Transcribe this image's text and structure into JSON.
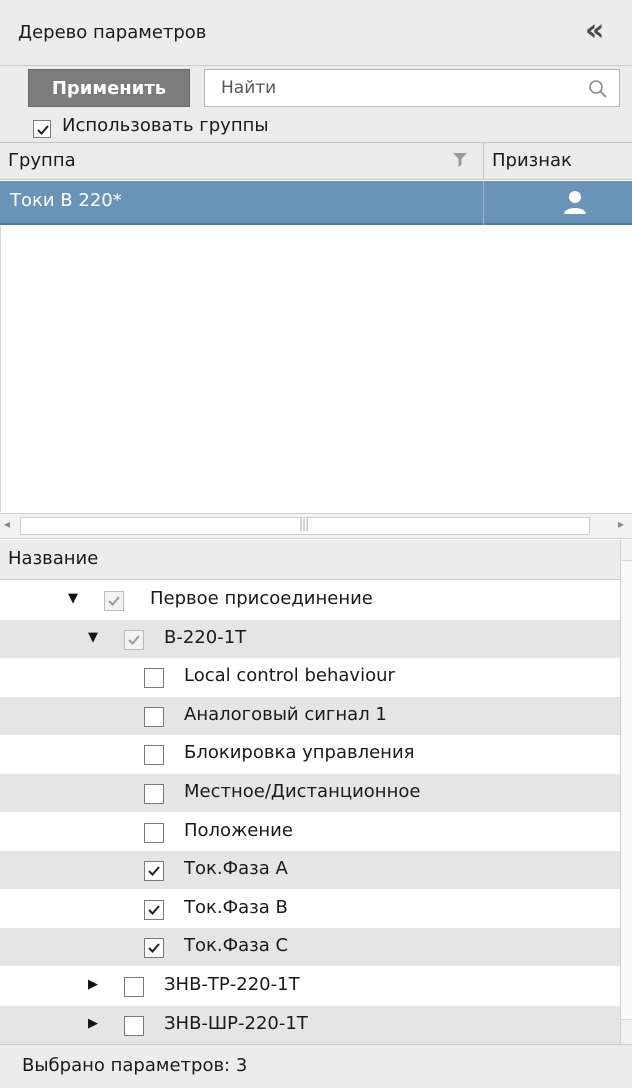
{
  "header": {
    "title": "Дерево параметров",
    "collapse_icon": "double-chevron-left-icon"
  },
  "toolbar": {
    "apply_label": "Применить",
    "search_placeholder": "Найти",
    "search_value": "",
    "search_icon": "search-icon"
  },
  "use_groups": {
    "label": "Использовать группы",
    "checked": true
  },
  "groups_table": {
    "columns": [
      "Группа",
      "Признак"
    ],
    "rows": [
      {
        "name": "Токи В 220*",
        "flag_icon": "user-icon",
        "selected": true
      }
    ]
  },
  "tree": {
    "column": "Название",
    "items": [
      {
        "label": "Первое присоединение",
        "level": 0,
        "expander": "expanded",
        "checked": true,
        "dim": true
      },
      {
        "label": "В-220-1Т",
        "level": 1,
        "expander": "expanded",
        "checked": true,
        "dim": true
      },
      {
        "label": "Local control behaviour",
        "level": 2,
        "expander": "none",
        "checked": false
      },
      {
        "label": "Аналоговый сигнал 1",
        "level": 2,
        "expander": "none",
        "checked": false
      },
      {
        "label": "Блокировка управления",
        "level": 2,
        "expander": "none",
        "checked": false
      },
      {
        "label": "Местное/Дистанционное",
        "level": 2,
        "expander": "none",
        "checked": false
      },
      {
        "label": "Положение",
        "level": 2,
        "expander": "none",
        "checked": false
      },
      {
        "label": "Ток.Фаза А",
        "level": 2,
        "expander": "none",
        "checked": true
      },
      {
        "label": "Ток.Фаза В",
        "level": 2,
        "expander": "none",
        "checked": true
      },
      {
        "label": "Ток.Фаза С",
        "level": 2,
        "expander": "none",
        "checked": true
      },
      {
        "label": "ЗНВ-ТР-220-1Т",
        "level": 1,
        "expander": "collapsed",
        "checked": false
      },
      {
        "label": "ЗНВ-ШР-220-1Т",
        "level": 1,
        "expander": "collapsed",
        "checked": false
      }
    ]
  },
  "status": {
    "text": "Выбрано параметров: 3"
  },
  "colors": {
    "selection": "#6a94b7",
    "panel": "#ececec",
    "apply_button": "#7c7c7c"
  }
}
